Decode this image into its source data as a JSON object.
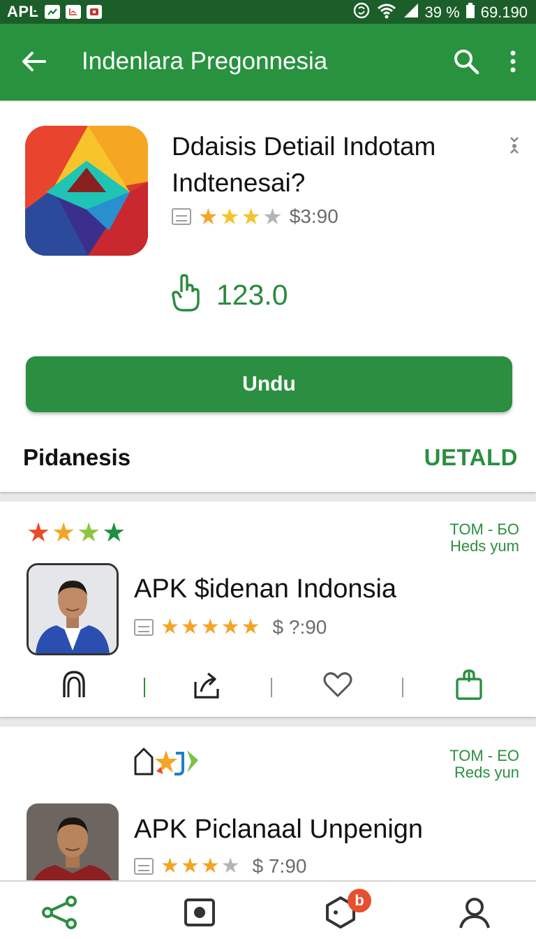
{
  "status_bar": {
    "left_text": "APĿ",
    "battery": "39 %",
    "time": "69.190"
  },
  "app_bar": {
    "title": "Indenlara Pregonnesia",
    "icons": [
      "back-arrow-icon",
      "search-icon",
      "more-vert-icon"
    ]
  },
  "app_detail": {
    "title": "Ddaisis Detiail Indotam Indtenesai?",
    "rating": 3.5,
    "price": "$3:90",
    "downloads": "123.0",
    "install_label": "Undu",
    "section_label": "Pidanesis",
    "section_link": "UETALD"
  },
  "items": [
    {
      "top_stars": 4,
      "side_line1": "TOM - БO",
      "side_line2": "Heds yum",
      "title": "APK $idenan Indonsia",
      "rating": 5,
      "price": "$ ?:90",
      "actions": [
        "headphones-icon",
        "share-icon",
        "heart-icon",
        "shopping-bag-icon"
      ]
    },
    {
      "side_line1": "TOM - EO",
      "side_line2": "Reds yun",
      "title": "APK Piclanaal Unpenign",
      "rating": 3,
      "price": "$ 7:90"
    }
  ],
  "bottom_nav": {
    "items": [
      "share-nodes-icon",
      "record-icon",
      "hexagon-icon",
      "profile-icon"
    ],
    "badge": "b"
  },
  "colors": {
    "status_bar": "#1b5e2a",
    "app_bar": "#28923f",
    "accent": "#2a8f40",
    "star": "#f4a424",
    "badge": "#e6502d"
  }
}
